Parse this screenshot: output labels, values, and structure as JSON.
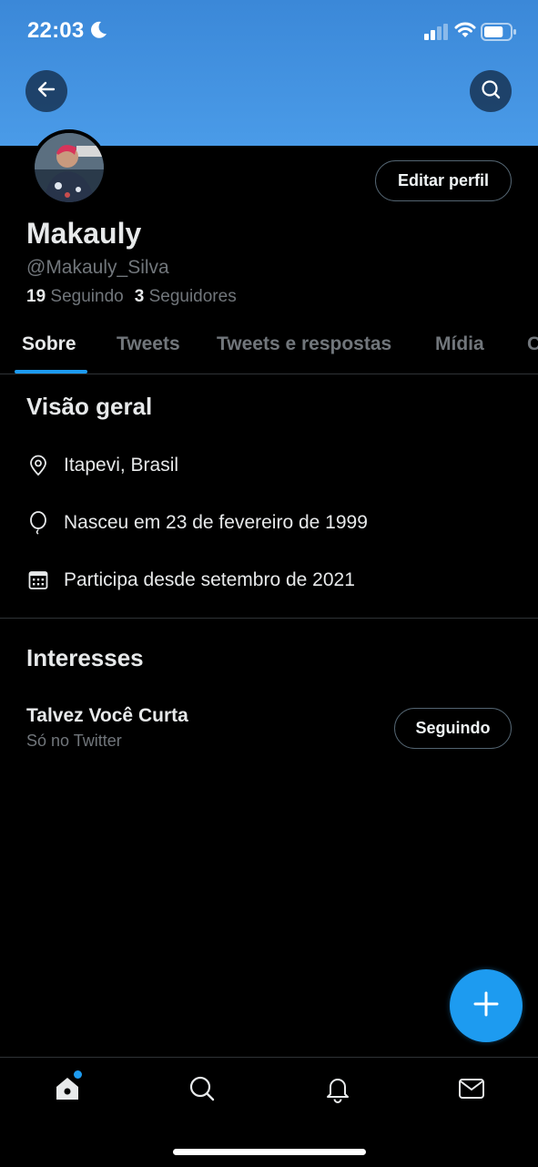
{
  "status_bar": {
    "time": "22:03",
    "moon_icon": "moon-icon",
    "battery_level": 0.75
  },
  "header": {
    "back_icon": "arrow-left-icon",
    "search_icon": "search-icon",
    "banner_color": "#4a9be8"
  },
  "profile": {
    "edit_label": "Editar perfil",
    "name": "Makauly",
    "handle": "@Makauly_Silva",
    "following_count": "19",
    "following_label": "Seguindo",
    "followers_count": "3",
    "followers_label": "Seguidores"
  },
  "tabs": [
    {
      "label": "Sobre",
      "active": true
    },
    {
      "label": "Tweets",
      "active": false
    },
    {
      "label": "Tweets e respostas",
      "active": false
    },
    {
      "label": "Mídia",
      "active": false
    },
    {
      "label": "C",
      "active": false
    }
  ],
  "overview": {
    "title": "Visão geral",
    "location": "Itapevi, Brasil",
    "birthday": "Nasceu em 23 de fevereiro de 1999",
    "joined": "Participa desde setembro de 2021"
  },
  "interests": {
    "title": "Interesses",
    "items": [
      {
        "name": "Talvez Você Curta",
        "subtitle": "Só no Twitter",
        "button": "Seguindo"
      }
    ]
  },
  "bottom_nav": [
    "home-icon",
    "search-icon",
    "bell-icon",
    "mail-icon"
  ],
  "colors": {
    "accent": "#1d9bf0",
    "background": "#000000",
    "muted": "#71767b"
  }
}
